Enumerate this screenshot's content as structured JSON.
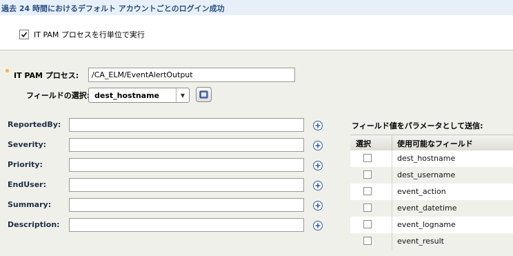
{
  "header": {
    "title": "過去 24 時間におけるデフォルト アカウントごとのログイン成功"
  },
  "run_per_row": {
    "label": "IT PAM プロセスを行単位で実行",
    "checked": true
  },
  "process": {
    "label": "IT PAM プロセス:",
    "value": "/CA_ELM/EventAlertOutput"
  },
  "field_select": {
    "label": "フィールドの選択:",
    "value": "dest_hostname",
    "button_icon": "notebook-icon"
  },
  "params": [
    {
      "label": "ReportedBy:",
      "value": ""
    },
    {
      "label": "Severity:",
      "value": ""
    },
    {
      "label": "Priority:",
      "value": ""
    },
    {
      "label": "EndUser:",
      "value": ""
    },
    {
      "label": "Summary:",
      "value": ""
    },
    {
      "label": "Description:",
      "value": ""
    }
  ],
  "field_table": {
    "title": "フィールド値をパラメータとして送信:",
    "col_select": "選択",
    "col_field": "使用可能なフィールド",
    "rows": [
      {
        "field": "dest_hostname",
        "checked": false
      },
      {
        "field": "dest_username",
        "checked": false
      },
      {
        "field": "event_action",
        "checked": false
      },
      {
        "field": "event_datetime",
        "checked": false
      },
      {
        "field": "event_logname",
        "checked": false
      },
      {
        "field": "event_result",
        "checked": false
      }
    ]
  },
  "colors": {
    "header_bg": "#e7f0f9",
    "header_text": "#2a4f80",
    "panel_bg": "#f0f0ea",
    "plus_icon": "#2c5ba6",
    "required_marker": "#f3b33d"
  }
}
